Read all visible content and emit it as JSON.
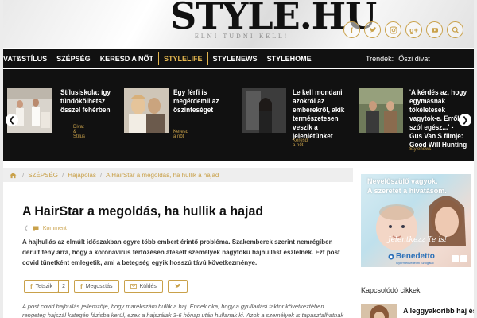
{
  "header": {
    "logo": "STYLE.HU",
    "tagline": "ÉLNI TUDNI KELL!",
    "social_icons": [
      "facebook-icon",
      "twitter-icon",
      "instagram-icon",
      "google-plus-icon",
      "youtube-icon",
      "search-icon"
    ],
    "accent": "#c9a14a"
  },
  "nav": {
    "items": [
      {
        "label": "VAT&STÍLUS",
        "active": false
      },
      {
        "label": "SZÉPSÉG",
        "active": false
      },
      {
        "label": "KERESD A NŐT",
        "active": false
      },
      {
        "label": "STYLELIFE",
        "active": true
      },
      {
        "label": "STYLENEWS",
        "active": false
      },
      {
        "label": "STYLEHOME",
        "active": false
      }
    ],
    "trend_label": "Trendek:",
    "trend_value": "Őszi divat"
  },
  "slider": {
    "slides": [
      {
        "title": "Stílusiskola: így tündökölhetsz ősszel fehérben",
        "category": "Divat & Stílus"
      },
      {
        "title": "Egy férfi is megérdemli az őszinteséget",
        "category": "Keresd a nőt"
      },
      {
        "title": "Le kell mondani azokról az emberekről, akik természetesen veszik a jelenlétünket",
        "category": "Keresd a nőt"
      },
      {
        "title": "'A kérdés az, hogy egymásnak tökéletesek vagytok-e. Erről szól egész...' - Gus Van S filmje: Good Will Hunting",
        "category": "Stylenews"
      }
    ]
  },
  "breadcrumb": [
    "SZÉPSÉG",
    "Hajápolás",
    "A HairStar a megoldás, ha hullik a hajad"
  ],
  "article": {
    "title": "A HairStar a megoldás, ha hullik a hajad",
    "meta_comment": "Komment",
    "lead": "A hajhullás az elmúlt időszakban egyre több embert érintő probléma. Szakemberek szerint nemrégiben derült fény arra, hogy a koronavírus fertőzésen átesett személyek nagyfokú hajhullást észlelnek. Ezt post covid tünetként emlegetik, ami a betegség egyik hosszú távú következménye.",
    "share": {
      "like_label": "Tetszik",
      "like_count": "2",
      "share_label": "Megosztás",
      "send_label": "Küldés"
    },
    "body": "A post covid hajhullás jellemzője, hogy marékszám hullik a haj. Ennek oka, hogy a gyulladási faktor következtében rengeteg hajszál kategén fázisba kerül, ezek a hajszálak 3-6 hónap után hullanak ki. Azok a személyek is tapasztalhatnak hajhullást,"
  },
  "ad": {
    "line1": "Nevelőszülő vagyok.",
    "line2": "A szeretet a hivatásom.",
    "script": "Jelentkezz Te is!",
    "brand": "Benedetto",
    "brand_sub": "Gyermekvédelmi Szolgálat"
  },
  "related": {
    "heading": "Kapcsolódó cikkek",
    "first_title": "A leggyakoribb haj és"
  }
}
